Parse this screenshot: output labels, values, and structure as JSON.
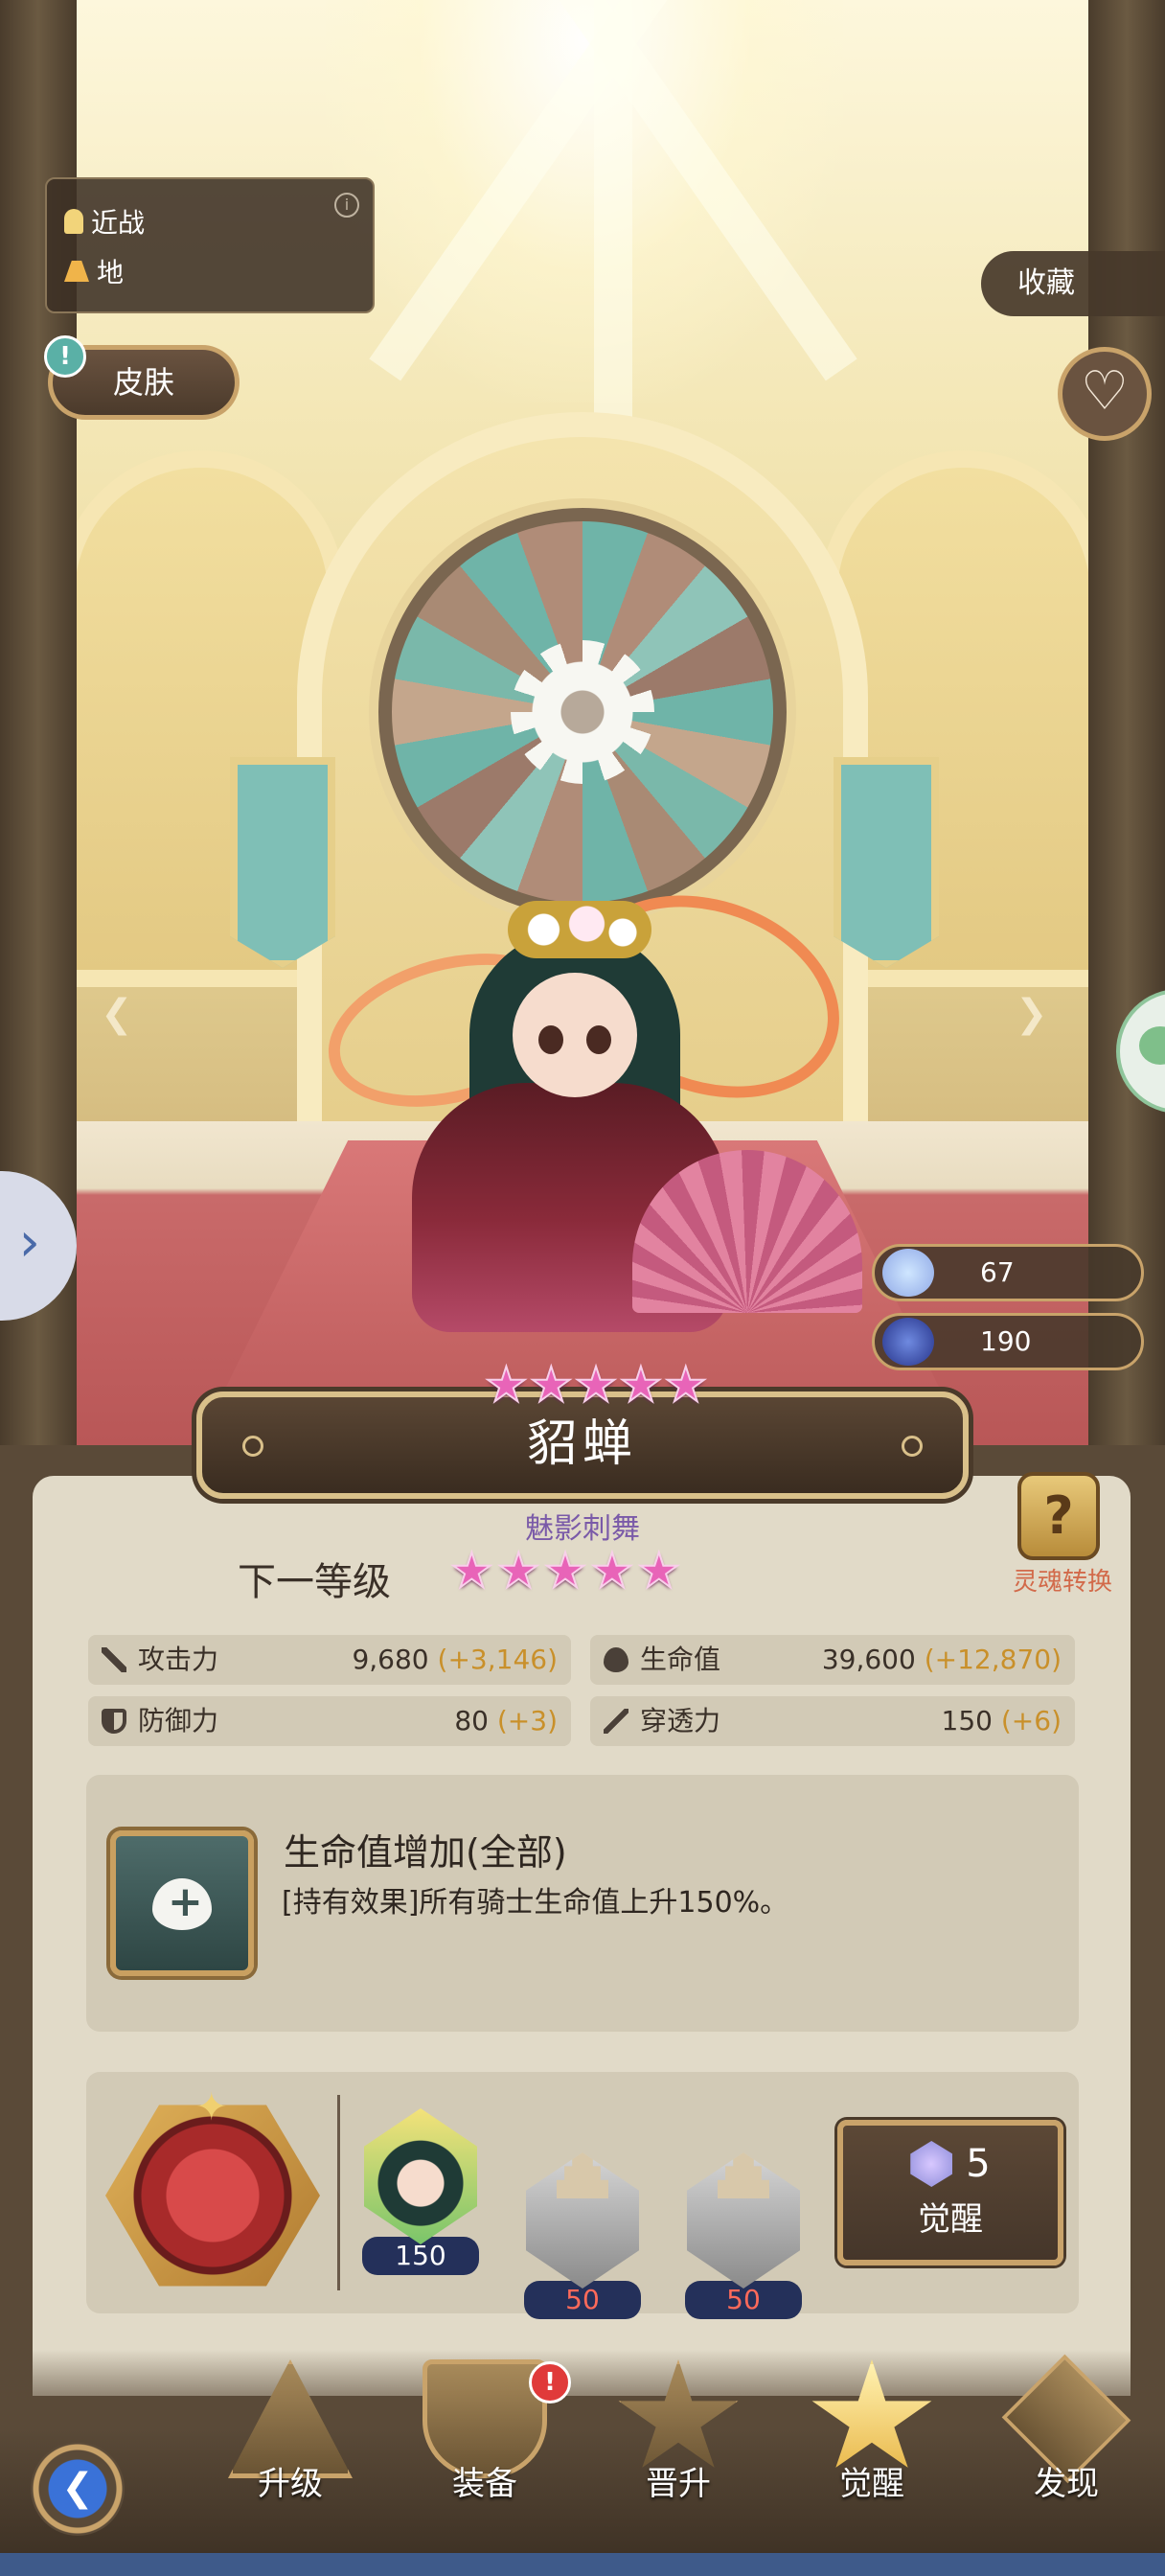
{
  "character": {
    "name": "貂蝉",
    "current_stars": 5,
    "attack_type": "近战",
    "terrain": "地"
  },
  "buttons": {
    "skin": "皮肤",
    "collect": "收藏",
    "soul_convert": "灵魂转换",
    "awaken": "觉醒"
  },
  "resources": [
    {
      "icon": "crystal-icon",
      "value": "67"
    },
    {
      "icon": "dark-crystal-icon",
      "value": "190"
    }
  ],
  "next_level": {
    "label": "下一等级",
    "skill_name": "魅影刺舞",
    "stars": 5
  },
  "stats": [
    {
      "label": "攻击力",
      "value": "9,680",
      "increase": "(+3,146)",
      "icon": "sword-icon"
    },
    {
      "label": "生命值",
      "value": "39,600",
      "increase": "(+12,870)",
      "icon": "heart-icon"
    },
    {
      "label": "防御力",
      "value": "80",
      "increase": "(+3)",
      "icon": "shield-icon"
    },
    {
      "label": "穿透力",
      "value": "150",
      "increase": "(+6)",
      "icon": "pierce-icon"
    }
  ],
  "effect": {
    "title": "生命值增加(全部)",
    "description": "[持有效果]所有骑士生命值上升150%。"
  },
  "awaken_materials": [
    {
      "type": "character-shard",
      "count": "150",
      "sufficient": true
    },
    {
      "type": "empty-slot",
      "count": "50",
      "sufficient": false
    },
    {
      "type": "empty-slot",
      "count": "50",
      "sufficient": false
    }
  ],
  "awaken_cost": "5",
  "nav": {
    "items": [
      "升级",
      "装备",
      "晋升",
      "觉醒",
      "发现"
    ],
    "active": "觉醒",
    "badge": "!"
  },
  "colors": {
    "star": "#e864b8",
    "increase": "#c9902a",
    "insufficient": "#ff6a5a",
    "skill_name": "#7a5aa8"
  }
}
